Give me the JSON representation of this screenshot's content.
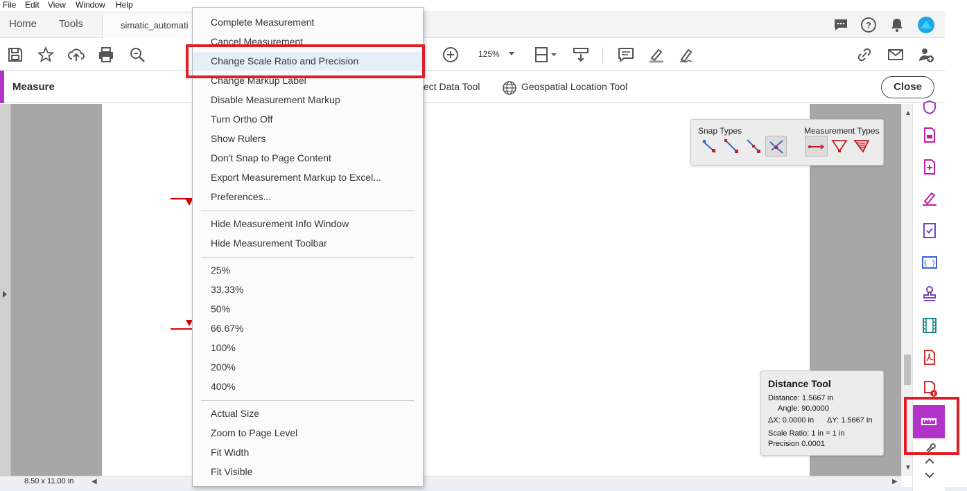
{
  "menubar": [
    "File",
    "Edit",
    "View",
    "Window",
    "Help"
  ],
  "tabs": {
    "home": "Home",
    "tools": "Tools",
    "document": "simatic_automati"
  },
  "toolbar": {
    "zoom": "125%"
  },
  "measure_bar": {
    "title": "Measure",
    "object_data_tool": "bject Data Tool",
    "geospatial_tool": "Geospatial Location Tool",
    "close": "Close"
  },
  "context_menu": {
    "group1": [
      "Complete Measurement",
      "Cancel Measurement",
      "Change Scale Ratio and Precision",
      "Change Markup Label",
      "Disable Measurement Markup",
      "Turn Ortho Off",
      "Show Rulers",
      "Don't Snap to Page Content",
      "Export Measurement Markup to Excel...",
      "Preferences..."
    ],
    "group2": [
      "Hide Measurement Info Window",
      "Hide Measurement Toolbar"
    ],
    "group3": [
      "25%",
      "33.33%",
      "50%",
      "66.67%",
      "100%",
      "200%",
      "400%"
    ],
    "group4": [
      "Actual Size",
      "Zoom to Page Level",
      "Fit Width",
      "Fit Visible"
    ],
    "highlighted_item": "Change Scale Ratio and Precision"
  },
  "measurement_toolbar": {
    "snap_types_label": "Snap Types",
    "measurement_types_label": "Measurement Types"
  },
  "distance_tool": {
    "title": "Distance Tool",
    "distance": "Distance:  1.5667 in",
    "angle": "Angle:  90.0000",
    "dx": "ΔX:  0.0000 in",
    "dy": "ΔY:  1.5667 in",
    "scale_ratio": "Scale Ratio:  1 in = 1 in",
    "precision": "Precision       0.0001"
  },
  "status": {
    "page_size": "8.50 x 11.00 in"
  },
  "colors": {
    "accent": "#b332c9",
    "highlight_red": "#e01d24",
    "measure_red": "#d40000"
  }
}
